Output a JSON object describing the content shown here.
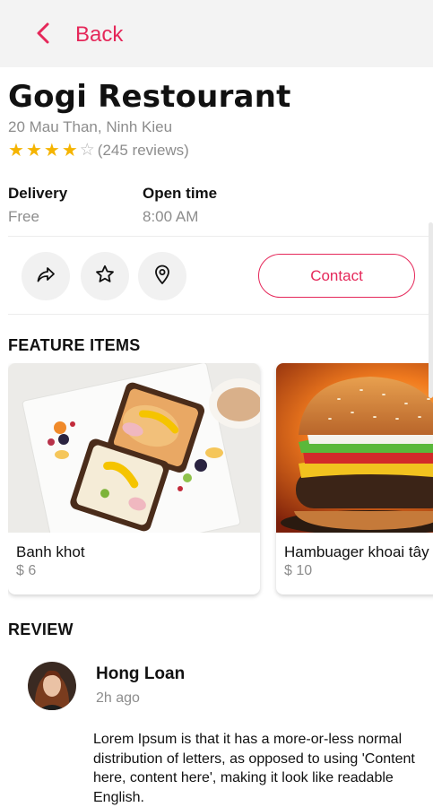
{
  "header": {
    "back_label": "Back",
    "accent_color": "#e5285a"
  },
  "restaurant": {
    "name": "Gogi Restourant",
    "address": "20 Mau Than, Ninh Kieu",
    "rating": 4,
    "max_rating": 5,
    "reviews_text": "(245 reviews)"
  },
  "info": {
    "delivery_label": "Delivery",
    "delivery_value": "Free",
    "open_label": "Open time",
    "open_value": "8:00 AM"
  },
  "actions": {
    "share_icon": "share-icon",
    "favorite_icon": "star-icon",
    "location_icon": "location-pin-icon",
    "contact_label": "Contact"
  },
  "features": {
    "title": "FEATURE ITEMS",
    "items": [
      {
        "name": "Banh khot",
        "price": "$ 6"
      },
      {
        "name": "Hambuager khoai tây",
        "price": "$ 10"
      }
    ]
  },
  "review": {
    "title": "REVIEW",
    "author": "Hong Loan",
    "time": "2h ago",
    "text": "Lorem Ipsum is that it has a more-or-less normal distribution of letters, as opposed to using 'Content here, content here', making it look like readable English."
  }
}
